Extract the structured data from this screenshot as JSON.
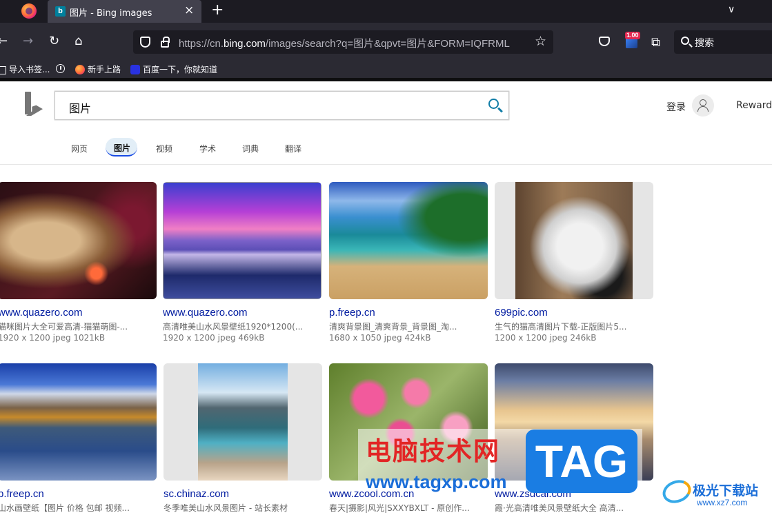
{
  "browser": {
    "tab": {
      "title": "图片 - Bing images",
      "favicon_letter": "b",
      "close": "×"
    },
    "new_tab": "+",
    "tab_list": "∨",
    "nav": {
      "back": "←",
      "forward": "→",
      "reload": "↻",
      "home": "⌂"
    },
    "url": {
      "prefix": "https://cn.",
      "host": "bing.com",
      "path": "/images/search?q=图片&qpvt=图片&FORM=IQFRML"
    },
    "star": "☆",
    "extension_badge": "1.00",
    "puzzle": "⧉",
    "search_placeholder": "搜索",
    "bookmarks": [
      "导入书签...",
      "新手上路",
      "百度一下，你就知道"
    ]
  },
  "bing": {
    "query": "图片",
    "login": "登录",
    "rewards": "Rewards",
    "scopes": [
      "网页",
      "图片",
      "视频",
      "学术",
      "词典",
      "翻译"
    ],
    "active_scope": "图片"
  },
  "results": [
    {
      "site": "www.quazero.com",
      "desc": "猫咪图片大全可爱高清-猫猫萌图-...",
      "meta": "1920 x 1200 jpeg 1021kB"
    },
    {
      "site": "www.quazero.com",
      "desc": "高清唯美山水风景壁纸1920*1200(...",
      "meta": "1920 x 1200 jpeg 469kB"
    },
    {
      "site": "p.freep.cn",
      "desc": "清爽背景图_清爽背景_背景图_淘...",
      "meta": "1680 x 1050 jpeg 424kB"
    },
    {
      "site": "699pic.com",
      "desc": "生气的猫高清图片下载-正版图片5...",
      "meta": "1200 x 1200 jpeg 246kB"
    },
    {
      "site": "p.freep.cn",
      "desc": "山水画壁纸【图片 价格 包邮 视频...",
      "meta": ""
    },
    {
      "site": "sc.chinaz.com",
      "desc": "冬季唯美山水风景图片 - 站长素材",
      "meta": ""
    },
    {
      "site": "www.zcool.com.cn",
      "desc": "春天|摄影|风光|SXXYBXLT - 原创作...",
      "meta": ""
    },
    {
      "site": "www.zsdcai.com",
      "desc": "霞·光高清唯美风景壁纸大全 高清...",
      "meta": ""
    }
  ],
  "watermarks": {
    "cn_text": "电脑技术网",
    "url": "www.tagxp.com",
    "tag": "TAG",
    "xz7_text": "极光下载站",
    "xz7_url": "www.xz7.com"
  }
}
